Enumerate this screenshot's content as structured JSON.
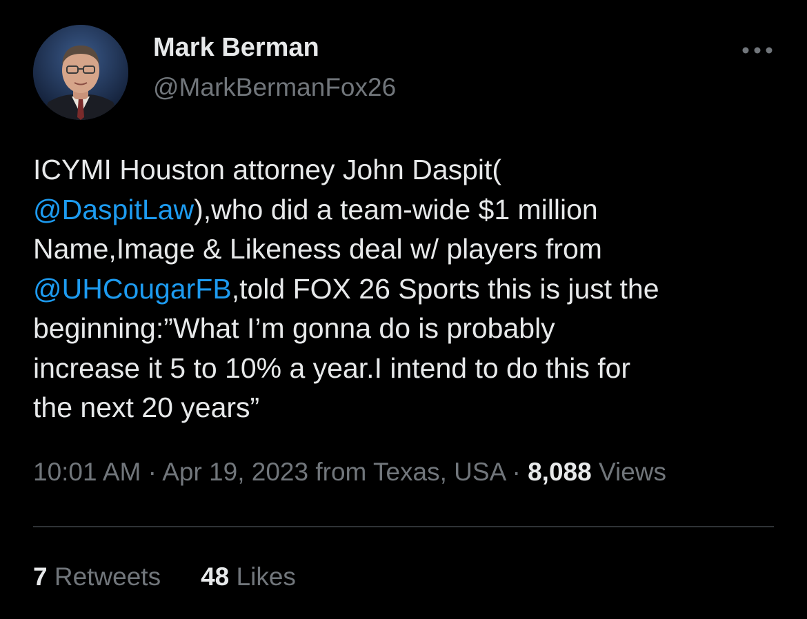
{
  "author": {
    "name": "Mark Berman",
    "handle": "@MarkBermanFox26"
  },
  "tweet": {
    "lines": [
      [
        {
          "t": "ICYMI Houston attorney John Daspit("
        }
      ],
      [
        {
          "t": "@DaspitLaw",
          "mention": true
        },
        {
          "t": "),who did a team-wide $1 million"
        }
      ],
      [
        {
          "t": "Name,Image & Likeness deal w/ players from"
        }
      ],
      [
        {
          "t": "@UHCougarFB",
          "mention": true
        },
        {
          "t": ",told FOX 26 Sports this is just the"
        }
      ],
      [
        {
          "t": "beginning:”What I’m gonna do is probably"
        }
      ],
      [
        {
          "t": "increase it 5 to 10% a year.I intend to do this for"
        }
      ],
      [
        {
          "t": "the next 20 years”"
        }
      ]
    ]
  },
  "meta": {
    "time": "10:01 AM",
    "sep1": " · ",
    "date_location": "Apr 19, 2023 from Texas, USA",
    "sep2": " · ",
    "views_count": "8,088",
    "views_label": " Views"
  },
  "stats": {
    "retweets_count": "7",
    "retweets_label": " Retweets",
    "likes_count": "48",
    "likes_label": " Likes"
  },
  "colors": {
    "background": "#000000",
    "text_primary": "#e7e9ea",
    "text_secondary": "#71767b",
    "link": "#1d9bf0",
    "divider": "#2f3336"
  },
  "icons": {
    "more": "more-horizontal-icon"
  }
}
